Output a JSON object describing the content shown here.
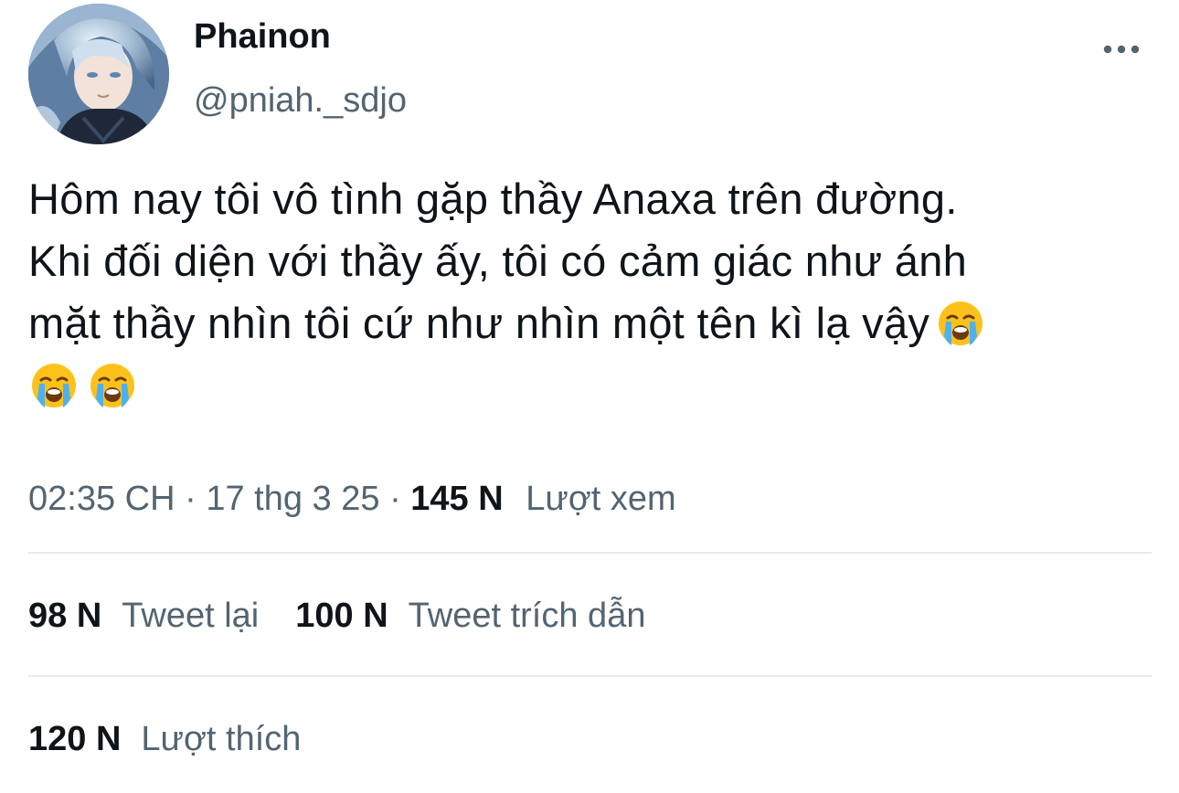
{
  "author": {
    "display_name": "Phainon",
    "handle": "@pniah._sdjo",
    "avatar": "anime-character-avatar"
  },
  "more_icon": "ellipsis-icon",
  "tweet": {
    "lines": [
      "Hôm nay tôi vô tình gặp thầy Anaxa trên đường.",
      "Khi đối diện với thầy ấy, tôi có cảm giác như ánh",
      "mặt thầy nhìn tôi cứ như nhìn một tên kì lạ vậy"
    ],
    "emoji": "loudly-crying-face"
  },
  "meta": {
    "time": "02:35 CH",
    "separator": "·",
    "date": "17 thg 3 25",
    "views_count": "145 N",
    "views_label": "Lượt xem"
  },
  "stats": {
    "retweets_count": "98 N",
    "retweets_label": "Tweet lại",
    "quotes_count": "100 N",
    "quotes_label": "Tweet trích dẫn",
    "likes_count": "120 N",
    "likes_label": "Lượt thích"
  },
  "colors": {
    "text_primary": "#0f1419",
    "text_secondary": "#536471",
    "divider": "#e6e9eb"
  }
}
